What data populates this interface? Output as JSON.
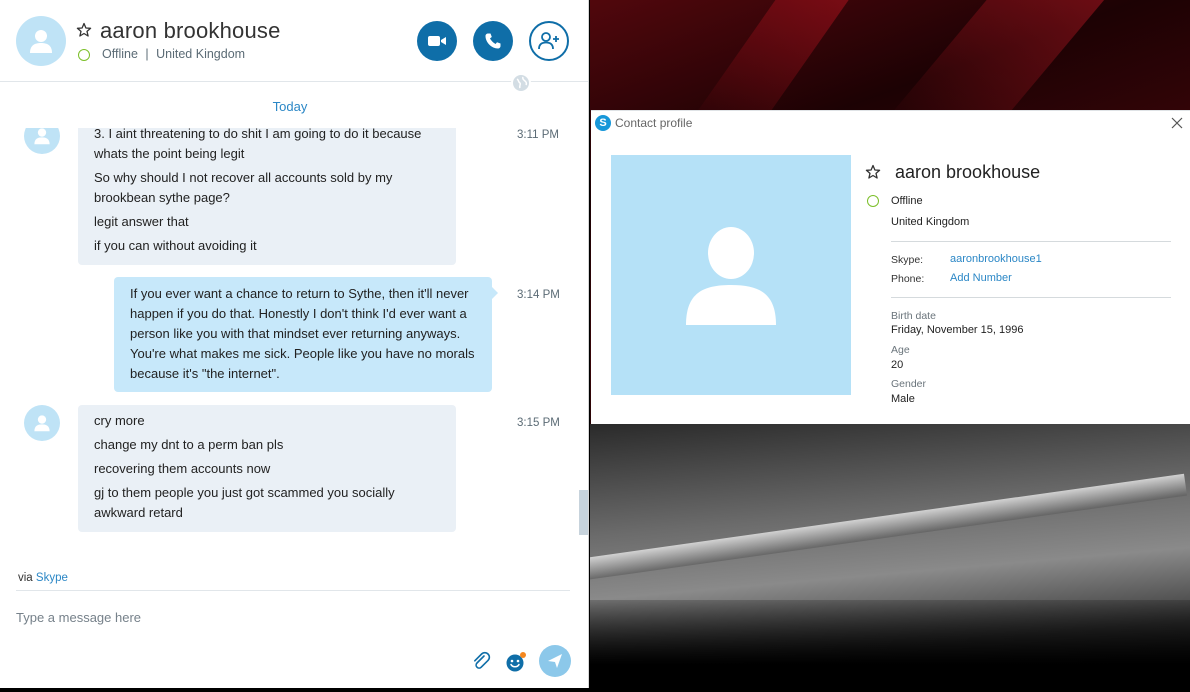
{
  "chat": {
    "contact_name": "aaron brookhouse",
    "status": "Offline",
    "separator": "|",
    "location": "United Kingdom",
    "date_divider": "Today",
    "messages": [
      {
        "direction": "incoming",
        "time": "3:11 PM",
        "lines": [
          "3. I aint threatening to do shit I am going to do it because whats the point being legit",
          "So why should I not recover all accounts sold by my brookbean sythe page?",
          "legit answer that",
          "if you can without avoiding it"
        ]
      },
      {
        "direction": "outgoing",
        "time": "3:14 PM",
        "text": "If you ever want a chance to return to Sythe, then it'll never happen if you do that. Honestly I don't think I'd ever want a person like you with that mindset ever returning anyways. You're what makes me sick. People like you have no morals because it's \"the internet\"."
      },
      {
        "direction": "incoming",
        "time": "3:15 PM",
        "lines": [
          "cry more",
          "change my dnt to a perm ban pls",
          "recovering them accounts now",
          "gj to them people you just got scammed you socially awkward retard"
        ]
      }
    ],
    "via_prefix": "via",
    "via_link": "Skype",
    "compose_placeholder": "Type a message here",
    "icons": [
      "star-icon",
      "video-icon",
      "phone-icon",
      "add-contact-icon",
      "globe-icon",
      "attach-icon",
      "emoji-icon",
      "send-icon"
    ]
  },
  "profile": {
    "window_title": "Contact profile",
    "name": "aaron brookhouse",
    "status": "Offline",
    "location": "United Kingdom",
    "skype_label": "Skype:",
    "skype_value": "aaronbrookhouse1",
    "phone_label": "Phone:",
    "phone_value": "Add Number",
    "birth_label": "Birth date",
    "birth_value": "Friday, November 15, 1996",
    "age_label": "Age",
    "age_value": "20",
    "gender_label": "Gender",
    "gender_value": "Male"
  },
  "colors": {
    "accent": "#0f6ea8",
    "link": "#2b87c6",
    "incoming_bubble": "#eaf0f6",
    "outgoing_bubble": "#c7e8fa",
    "status_ring": "#7cbf2a"
  }
}
